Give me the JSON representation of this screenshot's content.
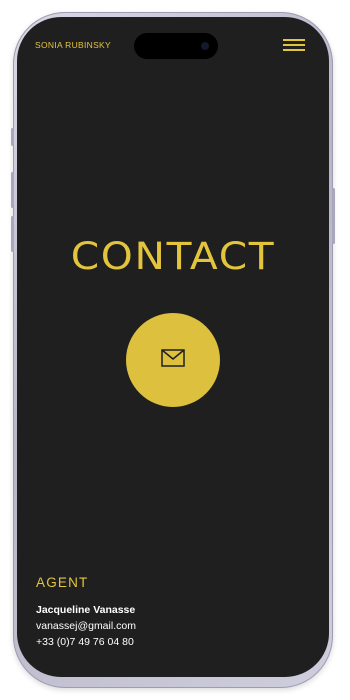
{
  "header": {
    "brand": "SONIA RUBINSKY",
    "menu_icon": "hamburger-menu-icon"
  },
  "main": {
    "heading": "CONTACT",
    "contact_icon": "envelope-icon"
  },
  "agent": {
    "title": "AGENT",
    "name": "Jacqueline Vanasse",
    "email": "vanassej@gmail.com",
    "phone": "+33 (0)7 49 76 04 80"
  },
  "colors": {
    "background": "#1f1f1f",
    "accent": "#e3c53d",
    "text": "#ffffff"
  }
}
